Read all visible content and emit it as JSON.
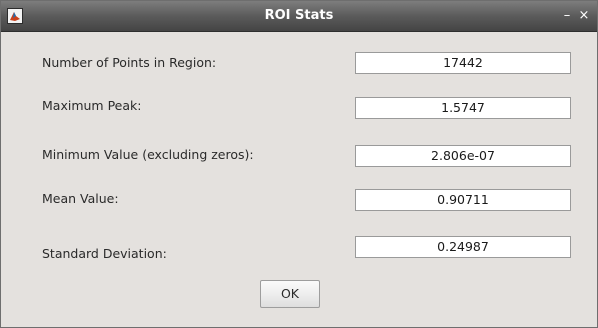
{
  "window": {
    "title": "ROI Stats",
    "minimize_glyph": "–",
    "close_glyph": "×"
  },
  "stats": [
    {
      "label": "Number of Points in Region:",
      "value": "17442"
    },
    {
      "label": "Maximum Peak:",
      "value": "1.5747"
    },
    {
      "label": "Minimum Value (excluding zeros):",
      "value": "2.806e-07"
    },
    {
      "label": "Mean Value:",
      "value": "0.90711"
    },
    {
      "label": "Standard Deviation:",
      "value": "0.24987"
    }
  ],
  "buttons": {
    "ok_label": "OK"
  },
  "colors": {
    "titlebar": "#4a4a4a",
    "dialog_background": "#e4e1de",
    "matlab_icon": "#c8401b"
  },
  "icons": {
    "app": "matlab-logo-icon"
  }
}
